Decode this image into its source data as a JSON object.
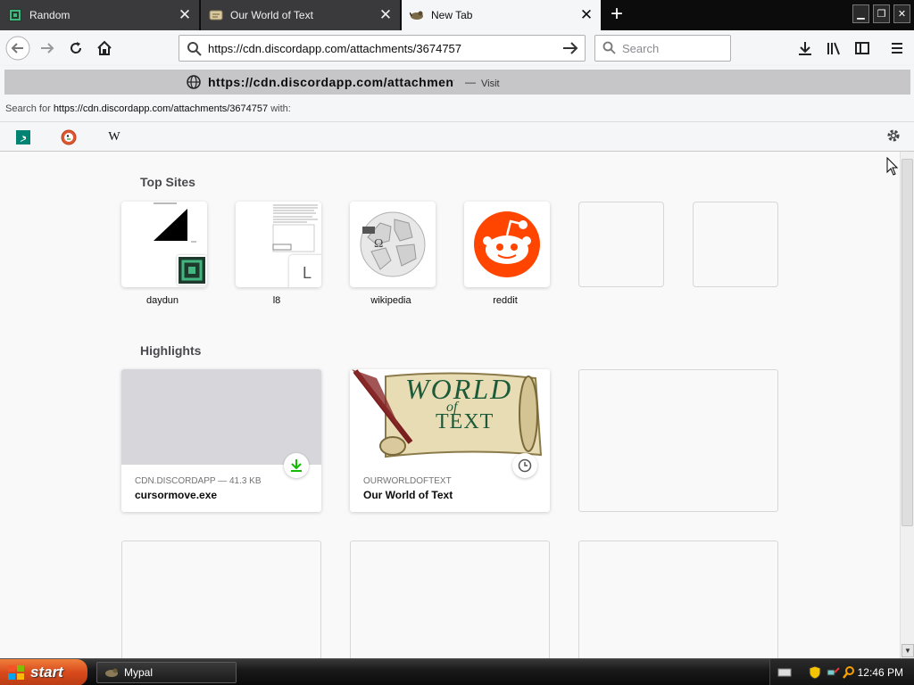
{
  "tabs": [
    {
      "title": "Random",
      "favicon": "discord-d-icon",
      "active": false
    },
    {
      "title": "Our World of Text",
      "favicon": "scroll-icon",
      "active": false
    },
    {
      "title": "New Tab",
      "favicon": "mypal-icon",
      "active": true
    }
  ],
  "urlbar": {
    "value": "https://cdn.discordapp.com/attachments/3674757",
    "search_placeholder": "Search"
  },
  "dropdown": {
    "suggestion_text": "https://cdn.discordapp.com/attachments",
    "suggestion_dash": "—",
    "suggestion_action": "Visit",
    "search_for_prefix": "Search for",
    "search_for_url": "https://cdn.discordapp.com/attachments/3674757",
    "search_for_suffix": "with:",
    "engines": [
      {
        "name": "Bing",
        "icon": "bing-icon"
      },
      {
        "name": "DuckDuckGo",
        "icon": "duckduckgo-icon"
      },
      {
        "name": "Wikipedia",
        "icon": "wikipedia-w-icon",
        "glyph": "W"
      }
    ]
  },
  "top_sites": {
    "title": "Top Sites",
    "items": [
      {
        "label": "daydun",
        "badge": "discord-d-icon"
      },
      {
        "label": "l8",
        "badge_letter": "L"
      },
      {
        "label": "wikipedia",
        "icon": "wikipedia-globe-icon",
        "glyph": "Ω"
      },
      {
        "label": "reddit",
        "icon": "reddit-icon"
      },
      {
        "label": ""
      },
      {
        "label": ""
      }
    ]
  },
  "highlights": {
    "title": "Highlights",
    "cards": [
      {
        "context": "CDN.DISCORDAPP — 41.3 KB",
        "title": "cursormove.exe",
        "badge": "download-icon"
      },
      {
        "context": "OURWORLDOFTEXT",
        "title": "Our World of Text",
        "badge": "clock-icon",
        "thumb_text_1": "WORLD",
        "thumb_text_2": "of",
        "thumb_text_3": "TEXT"
      }
    ]
  },
  "taskbar": {
    "start_label": "start",
    "task_label": "Mypal",
    "clock": "12:46 PM"
  },
  "colors": {
    "accent": "#0a84ff",
    "download_green": "#12bc00",
    "reddit": "#ff4500",
    "discord_green": "#43b581"
  }
}
